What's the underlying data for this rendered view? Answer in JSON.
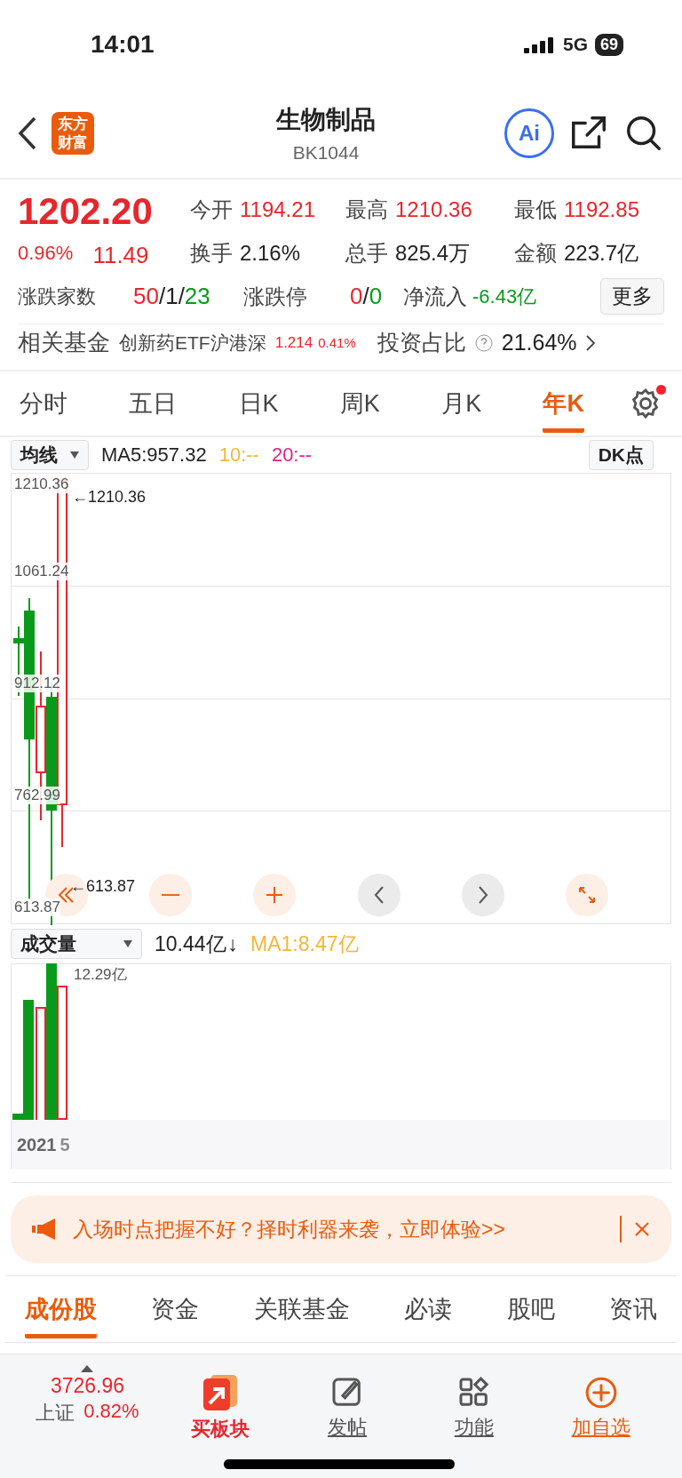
{
  "status_bar": {
    "time": "14:01",
    "network": "5G",
    "battery": "69"
  },
  "header": {
    "logo": "东方财富",
    "title": "生物制品",
    "code": "BK1044",
    "ai": "Ai"
  },
  "quote": {
    "price": "1202.20",
    "change_pct": "0.96%",
    "change": "11.49",
    "stats": [
      {
        "label": "今开",
        "value": "1194.21",
        "color": "#e8262d"
      },
      {
        "label": "最高",
        "value": "1210.36",
        "color": "#e8262d"
      },
      {
        "label": "最低",
        "value": "1192.85",
        "color": "#e8262d"
      },
      {
        "label": "换手",
        "value": "2.16%",
        "color": "#222222"
      },
      {
        "label": "总手",
        "value": "825.4万",
        "color": "#222222"
      },
      {
        "label": "金额",
        "value": "223.7亿",
        "color": "#222222"
      }
    ],
    "breadth": {
      "label": "涨跌家数",
      "up": "50",
      "separators": [
        "/",
        "/"
      ],
      "flat": "1",
      "down": "23"
    },
    "limits": {
      "label": "涨跌停",
      "up": "0",
      "separator": "/",
      "down": "0"
    },
    "inflow": {
      "label": "净流入",
      "value": "-6.43亿"
    },
    "more": "更多"
  },
  "fund": {
    "label": "相关基金",
    "name": "创新药ETF沪港深",
    "price": "1.214",
    "pct": "0.41%",
    "ratio_label": "投资占比",
    "ratio": "21.64%"
  },
  "period_tabs": [
    {
      "label": "分时",
      "selected": false
    },
    {
      "label": "五日",
      "selected": false
    },
    {
      "label": "日K",
      "selected": false
    },
    {
      "label": "周K",
      "selected": false
    },
    {
      "label": "月K",
      "selected": false
    },
    {
      "label": "年K",
      "selected": true
    }
  ],
  "settings_badge": true,
  "ma_bar": {
    "selector": "均线",
    "ma5": "MA5:957.32",
    "ma10": "10:--",
    "ma20": "20:--",
    "dk": "DK点"
  },
  "price_chart": {
    "axis_labels": [
      "1210.36",
      "1061.24",
      "912.12",
      "762.99",
      "613.87"
    ],
    "high_marker": "←1210.36",
    "low_marker": "←613.87"
  },
  "volume": {
    "selector": "成交量",
    "value": "10.44亿",
    "arrow": "↓",
    "ma1": "MA1:8.47亿",
    "max_label": "12.29亿",
    "year": "2021",
    "faded_tick": "5"
  },
  "banner": {
    "text": "入场时点把握不好？择时利器来袭，立即体验>>"
  },
  "content_tabs": [
    {
      "label": "成份股",
      "selected": true
    },
    {
      "label": "资金",
      "selected": false
    },
    {
      "label": "关联基金",
      "selected": false
    },
    {
      "label": "必读",
      "selected": false
    },
    {
      "label": "股吧",
      "selected": false
    },
    {
      "label": "资讯",
      "selected": false
    }
  ],
  "bottom_bar": {
    "index": {
      "value": "3726.96",
      "name": "上证",
      "pct": "0.82%"
    },
    "actions": [
      {
        "kind": "buy",
        "label": "买板块"
      },
      {
        "kind": "post",
        "label": "发帖"
      },
      {
        "kind": "tools",
        "label": "功能"
      },
      {
        "kind": "watch",
        "label": "加自选"
      }
    ]
  }
}
